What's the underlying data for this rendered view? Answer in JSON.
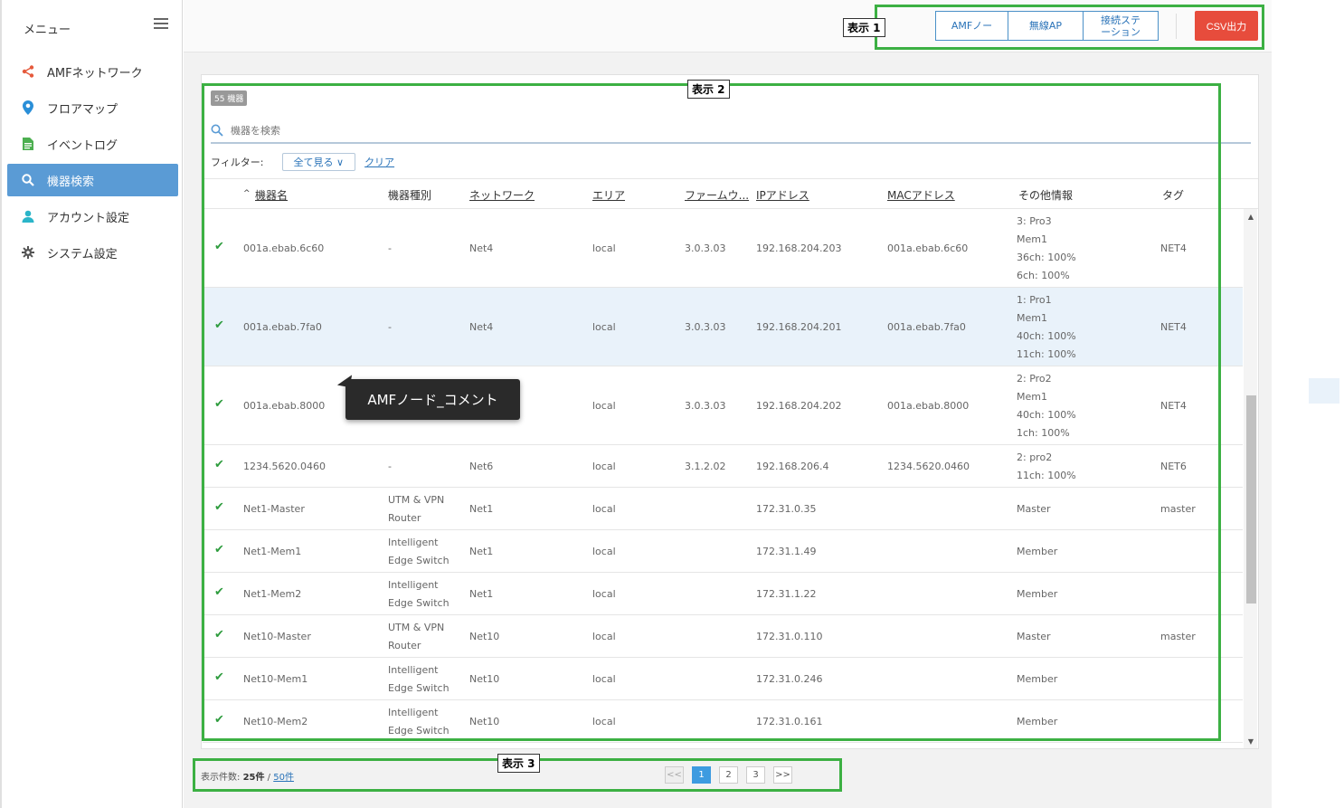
{
  "sidebar": {
    "menu_label": "メニュー",
    "items": [
      {
        "label": "AMFネットワーク",
        "icon": "share-icon",
        "color": "#e55a3c"
      },
      {
        "label": "フロアマップ",
        "icon": "map-pin-icon",
        "color": "#2a8fd8"
      },
      {
        "label": "イベントログ",
        "icon": "document-icon",
        "color": "#4caf50"
      },
      {
        "label": "機器検索",
        "icon": "search-icon",
        "color": "#ffffff"
      },
      {
        "label": "アカウント設定",
        "icon": "user-icon",
        "color": "#2bb5c9"
      },
      {
        "label": "システム設定",
        "icon": "gear-icon",
        "color": "#555555"
      }
    ]
  },
  "annotations": {
    "label1": "表示 1",
    "label2": "表示 2",
    "label3": "表示 3"
  },
  "toolbar": {
    "seg1": "AMFノー",
    "seg2": "無線AP",
    "seg3_line1": "接続ステ",
    "seg3_line2": "ーション",
    "csv": "CSV出力"
  },
  "panel": {
    "count_badge": "55 機器",
    "search_placeholder": "機器を検索",
    "filter_label": "フィルター:",
    "filter_value": "全て見る ∨",
    "filter_clear": "クリア"
  },
  "table": {
    "headers": [
      "機器名",
      "機器種別",
      "ネットワーク",
      "エリア",
      "ファームウ...",
      "IPアドレス",
      "MACアドレス",
      "その他情報",
      "タグ"
    ],
    "sort_indicator": "^",
    "rows": [
      {
        "name": "001a.ebab.6c60",
        "type1": "-",
        "type2": "",
        "network": "Net4",
        "area": "local",
        "fw": "3.0.3.03",
        "ip": "192.168.204.203",
        "mac": "001a.ebab.6c60",
        "info": [
          "3: Pro3",
          "Mem1",
          "36ch: 100%",
          "6ch: 100%"
        ],
        "tag": "NET4"
      },
      {
        "name": "001a.ebab.7fa0",
        "type1": "-",
        "type2": "",
        "network": "Net4",
        "area": "local",
        "fw": "3.0.3.03",
        "ip": "192.168.204.201",
        "mac": "001a.ebab.7fa0",
        "info": [
          "1: Pro1",
          "Mem1",
          "40ch: 100%",
          "11ch: 100%"
        ],
        "tag": "NET4"
      },
      {
        "name": "001a.ebab.8000",
        "type1": "",
        "type2": "",
        "network": "",
        "area": "local",
        "fw": "3.0.3.03",
        "ip": "192.168.204.202",
        "mac": "001a.ebab.8000",
        "info": [
          "2: Pro2",
          "Mem1",
          "40ch: 100%",
          "1ch: 100%"
        ],
        "tag": "NET4"
      },
      {
        "name": "1234.5620.0460",
        "type1": "-",
        "type2": "",
        "network": "Net6",
        "area": "local",
        "fw": "3.1.2.02",
        "ip": "192.168.206.4",
        "mac": "1234.5620.0460",
        "info": [
          "2: pro2",
          "11ch: 100%",
          "",
          ""
        ],
        "tag": "NET6"
      },
      {
        "name": "Net1-Master",
        "type1": "UTM & VPN",
        "type2": "Router",
        "network": "Net1",
        "area": "local",
        "fw": "",
        "ip": "172.31.0.35",
        "mac": "",
        "info": [
          "Master",
          "",
          "",
          ""
        ],
        "tag": "master"
      },
      {
        "name": "Net1-Mem1",
        "type1": "Intelligent",
        "type2": "Edge Switch",
        "network": "Net1",
        "area": "local",
        "fw": "",
        "ip": "172.31.1.49",
        "mac": "",
        "info": [
          "Member",
          "",
          "",
          ""
        ],
        "tag": ""
      },
      {
        "name": "Net1-Mem2",
        "type1": "Intelligent",
        "type2": "Edge Switch",
        "network": "Net1",
        "area": "local",
        "fw": "",
        "ip": "172.31.1.22",
        "mac": "",
        "info": [
          "Member",
          "",
          "",
          ""
        ],
        "tag": ""
      },
      {
        "name": "Net10-Master",
        "type1": "UTM & VPN",
        "type2": "Router",
        "network": "Net10",
        "area": "local",
        "fw": "",
        "ip": "172.31.0.110",
        "mac": "",
        "info": [
          "Master",
          "",
          "",
          ""
        ],
        "tag": "master"
      },
      {
        "name": "Net10-Mem1",
        "type1": "Intelligent",
        "type2": "Edge Switch",
        "network": "Net10",
        "area": "local",
        "fw": "",
        "ip": "172.31.0.246",
        "mac": "",
        "info": [
          "Member",
          "",
          "",
          ""
        ],
        "tag": ""
      },
      {
        "name": "Net10-Mem2",
        "type1": "Intelligent",
        "type2": "Edge Switch",
        "network": "Net10",
        "area": "local",
        "fw": "",
        "ip": "172.31.0.161",
        "mac": "",
        "info": [
          "Member",
          "",
          "",
          ""
        ],
        "tag": ""
      }
    ]
  },
  "tooltip": "AMFノード_コメント",
  "footer": {
    "info_label": "表示件数:",
    "info_count": "25件",
    "info_sep": "/",
    "info_link": "50件",
    "pager": [
      "<<",
      "1",
      "2",
      "3",
      ">>"
    ]
  },
  "colors": {
    "accent": "#5a9bd5",
    "frame": "#3cb043",
    "csv": "#e74c3c",
    "check": "#2e9c3e"
  }
}
